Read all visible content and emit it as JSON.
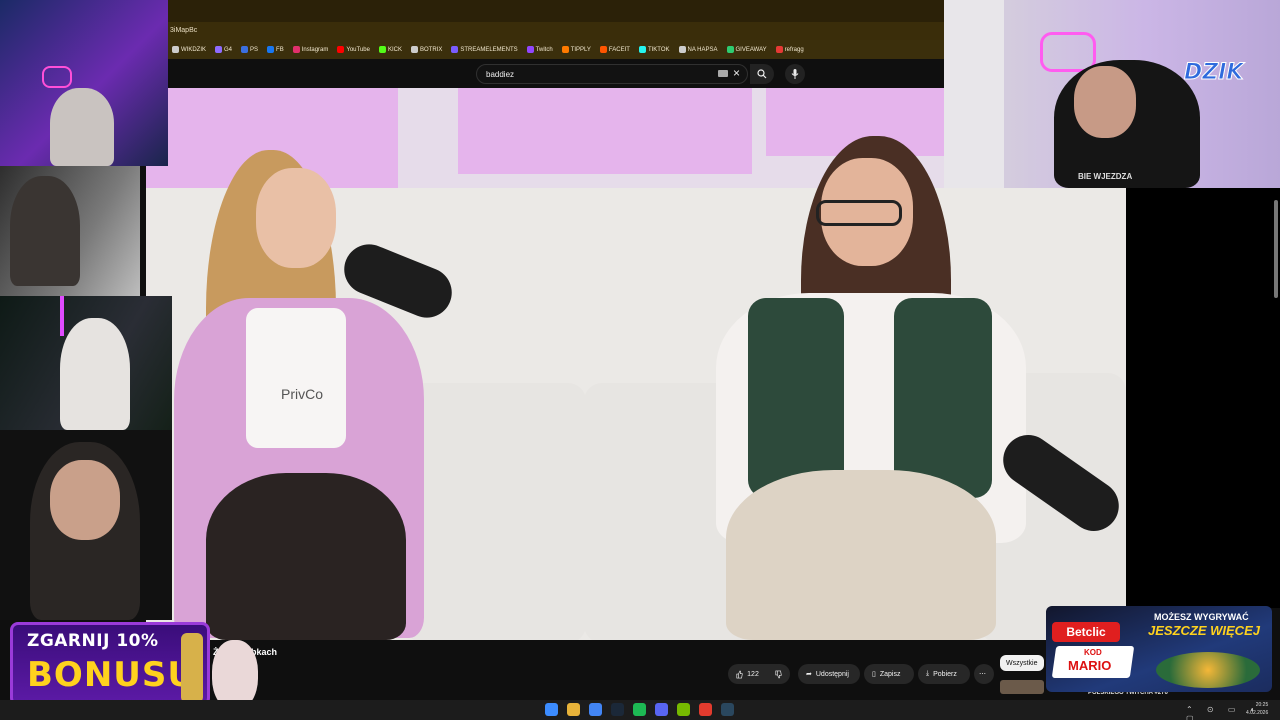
{
  "browser": {
    "url_partial": "3iMapBc",
    "bookmarks": [
      "WIKDZIK",
      "G4",
      "PS",
      "FB",
      "Instagram",
      "YouTube",
      "KICK",
      "BOTRIX",
      "STREAMELEMENTS",
      "Twitch",
      "TIPPLY",
      "FACEIT",
      "TIKTOK",
      "NA HAPSA",
      "GIVEAWAY",
      "refragg"
    ],
    "bookmark_colors": [
      "#cccccc",
      "#8e6bff",
      "#3b6fe0",
      "#1877f2",
      "#e1306c",
      "#ff0000",
      "#53fc18",
      "#cccccc",
      "#7a5cff",
      "#9146ff",
      "#ff7a00",
      "#ff5500",
      "#25f4ee",
      "#cccccc",
      "#2ecc71",
      "#e53935"
    ]
  },
  "youtube": {
    "search_value": "baddiez",
    "clear_icon": "×",
    "video_title": "Żyw… robkach",
    "actions": {
      "like_count": "122",
      "share": "Udostępnij",
      "save": "Zapisz",
      "download": "Pobierz",
      "more": "⋯"
    },
    "filter_chip": "Wszystkie",
    "reco_title": "POLSKIEGO TWITCHA #276",
    "video_shirt_text": "PrivCo"
  },
  "overlays": {
    "bonus_line1": "ZGARNIJ 10%",
    "bonus_line2": "BONUSU",
    "betclic_logo": "Betclic",
    "betclic_tag1": "MOŻESZ WYGRYWAĆ",
    "betclic_tag2": "JESZCZE WIĘCEJ",
    "betclic_code_label": "KOD",
    "betclic_code": "MARIO",
    "dzik_logo": "DZIK",
    "streamer_shirt": "BIE WJEZDZA"
  },
  "taskbar": {
    "apps": [
      "windows",
      "search",
      "chrome",
      "steam",
      "spotify",
      "discord",
      "nvidia",
      "rockstar",
      "steam2"
    ],
    "app_colors": [
      "#3c8cff",
      "#e8b33a",
      "#4285f4",
      "#1b2838",
      "#1db954",
      "#5865f2",
      "#76b900",
      "#e23b2e",
      "#2a475e"
    ],
    "time": "20:25",
    "date": "4.02.2026"
  }
}
